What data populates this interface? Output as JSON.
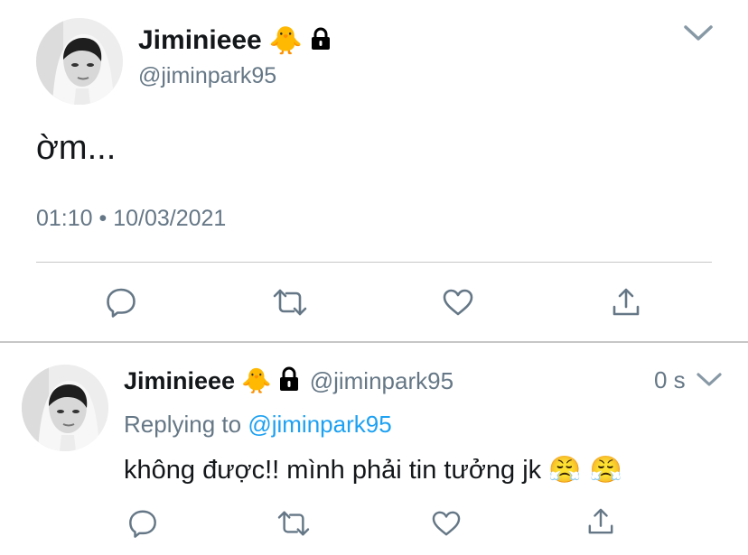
{
  "main_tweet": {
    "display_name": "Jiminieee",
    "handle": "@jiminpark95",
    "badge_emoji": "🐥",
    "text": "ờm...",
    "timestamp": "01:10 • 10/03/2021",
    "actions": [
      "reply-icon",
      "retweet-icon",
      "like-icon",
      "share-icon"
    ]
  },
  "reply_tweet": {
    "display_name": "Jiminieee",
    "handle": "@jiminpark95",
    "badge_emoji": "🐥",
    "age": "0 s",
    "replying_prefix": "Replying to",
    "replying_handle": "@jiminpark95",
    "text": "không được!! mình phải tin tưởng jk",
    "text_emoji": "😤 😤",
    "actions": [
      "reply-icon",
      "retweet-icon",
      "like-icon",
      "share-icon"
    ]
  },
  "colors": {
    "icon_gray": "#657786",
    "link_blue": "#1da1f2",
    "divider": "#c6c6c8"
  }
}
